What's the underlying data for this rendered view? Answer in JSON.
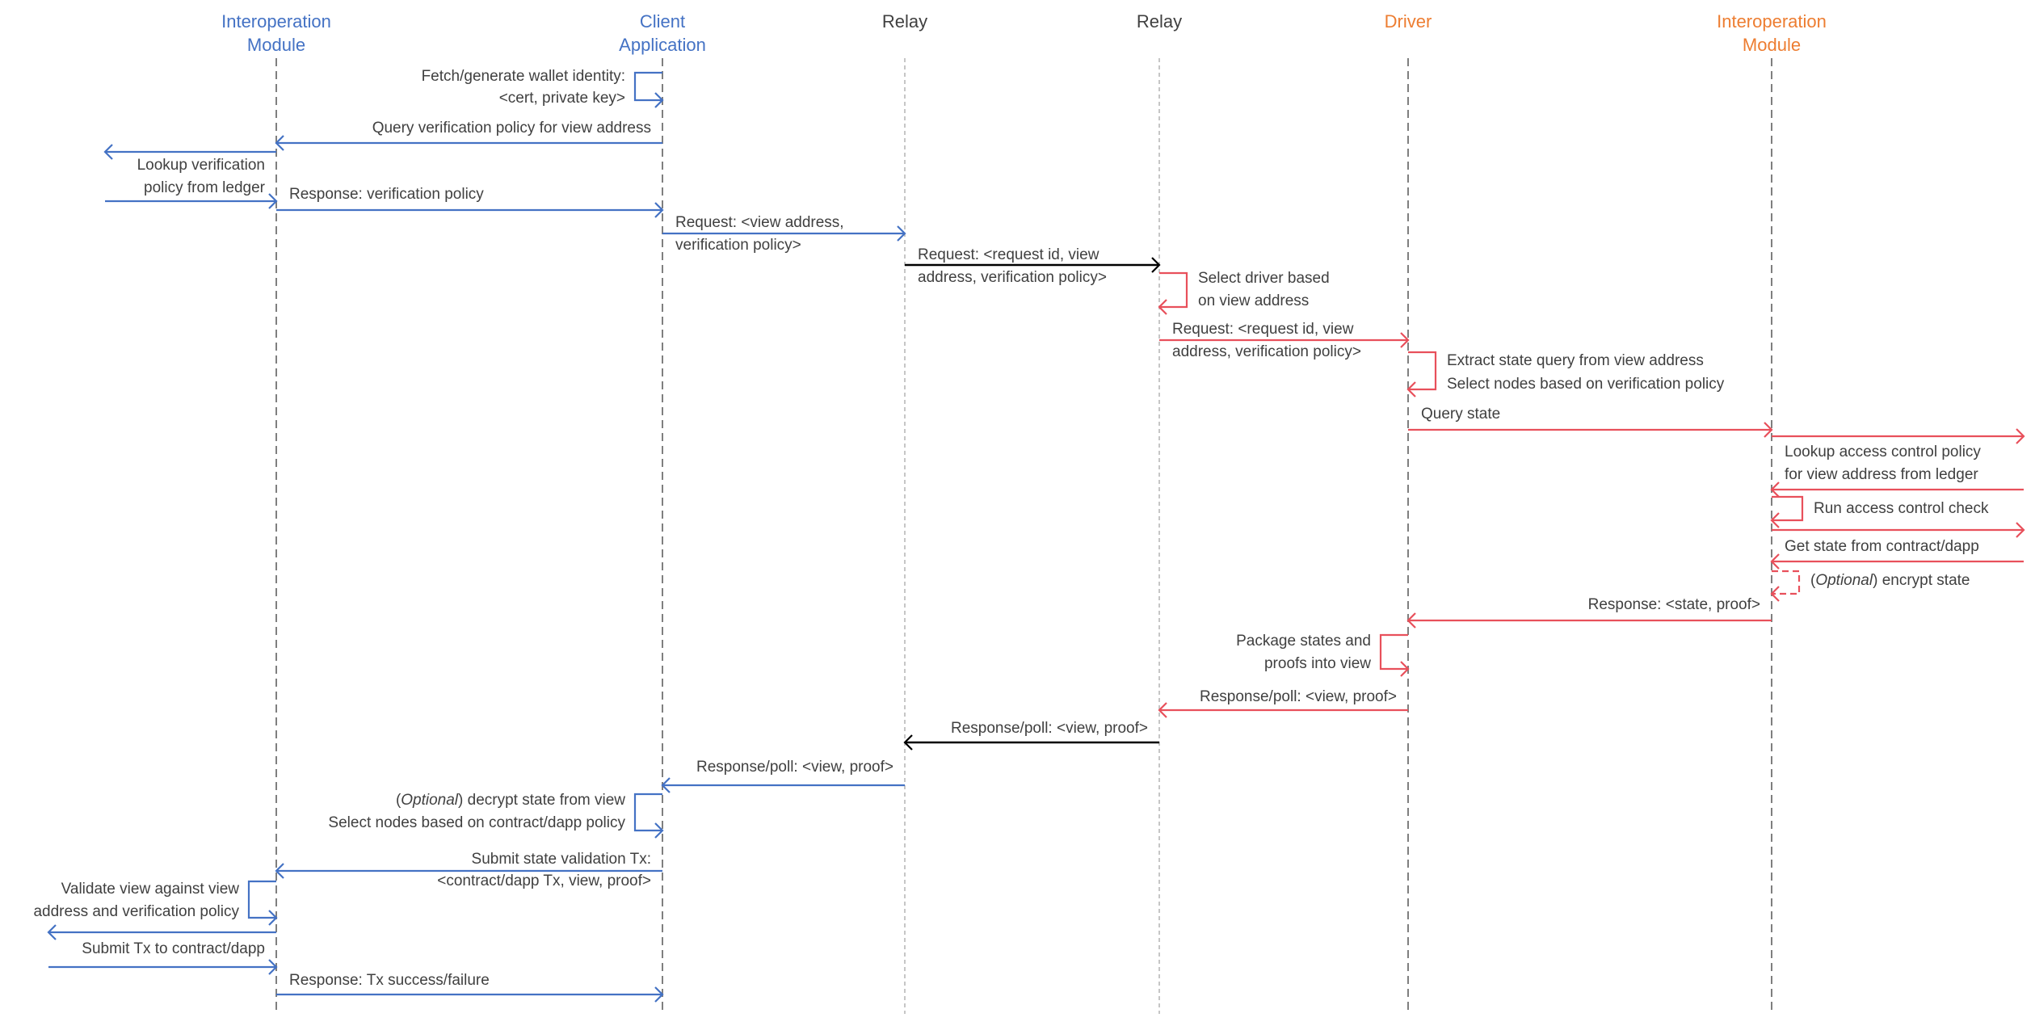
{
  "colors": {
    "blue": "#4472C4",
    "red": "#E8505B",
    "orange": "#ED7D31",
    "black": "#000000",
    "text": "#404040",
    "lifeline": "#808080"
  },
  "participants": [
    {
      "id": "im-left",
      "label": [
        "Interoperation",
        "Module"
      ],
      "color": "blue"
    },
    {
      "id": "client",
      "label": [
        "Client",
        "Application"
      ],
      "color": "blue"
    },
    {
      "id": "relay-1",
      "label": [
        "Relay"
      ],
      "color": "text"
    },
    {
      "id": "relay-2",
      "label": [
        "Relay"
      ],
      "color": "text"
    },
    {
      "id": "driver",
      "label": [
        "Driver"
      ],
      "color": "orange"
    },
    {
      "id": "im-right",
      "label": [
        "Interoperation",
        "Module"
      ],
      "color": "orange"
    }
  ],
  "messages": [
    {
      "type": "self",
      "at": 1,
      "side": "left",
      "color": "blue",
      "text": [
        "Fetch/generate wallet identity:",
        "<cert, private key>"
      ]
    },
    {
      "type": "arrow",
      "from": 1,
      "to": 0,
      "color": "blue",
      "text": [
        "Query verification policy for view address"
      ]
    },
    {
      "type": "external-out",
      "at": 0,
      "side": "left",
      "color": "blue",
      "text": []
    },
    {
      "type": "note",
      "at": 0,
      "side": "left",
      "text": [
        "Lookup verification",
        "policy from ledger"
      ]
    },
    {
      "type": "external-in",
      "at": 0,
      "side": "left",
      "color": "blue",
      "text": []
    },
    {
      "type": "arrow",
      "from": 0,
      "to": 1,
      "color": "blue",
      "text": [
        "Response: verification policy"
      ]
    },
    {
      "type": "arrow",
      "from": 1,
      "to": 2,
      "color": "blue",
      "text": [
        "Request: <view address,",
        "verification policy>"
      ]
    },
    {
      "type": "arrow",
      "from": 2,
      "to": 3,
      "color": "black",
      "text": [
        "Request: <request id, view",
        "address, verification policy>"
      ]
    },
    {
      "type": "self",
      "at": 3,
      "side": "right",
      "color": "red",
      "text": [
        "Select driver based",
        "on view address"
      ]
    },
    {
      "type": "arrow",
      "from": 3,
      "to": 4,
      "color": "red",
      "text": [
        "Request: <request id, view",
        "address, verification policy>"
      ]
    },
    {
      "type": "self",
      "at": 4,
      "side": "right",
      "color": "red",
      "text": [
        "Extract state query from view address",
        "Select nodes based on verification policy"
      ]
    },
    {
      "type": "arrow",
      "from": 4,
      "to": 5,
      "color": "red",
      "text": [
        "Query state"
      ]
    },
    {
      "type": "external-out",
      "at": 5,
      "side": "right",
      "color": "red",
      "text": []
    },
    {
      "type": "note",
      "at": 5,
      "side": "right",
      "text": [
        "Lookup access control policy",
        "for view address from ledger"
      ]
    },
    {
      "type": "external-in",
      "at": 5,
      "side": "right",
      "color": "red",
      "text": []
    },
    {
      "type": "self",
      "at": 5,
      "side": "right",
      "color": "red",
      "text": [
        "Run access control check"
      ]
    },
    {
      "type": "external-out",
      "at": 5,
      "side": "right",
      "color": "red",
      "text": []
    },
    {
      "type": "note",
      "at": 5,
      "side": "right",
      "text": [
        "Get state from contract/dapp"
      ]
    },
    {
      "type": "external-in",
      "at": 5,
      "side": "right",
      "color": "red",
      "text": []
    },
    {
      "type": "self",
      "at": 5,
      "side": "right",
      "color": "red",
      "dashed": true,
      "text": [
        "(",
        "Optional",
        ") encrypt state"
      ]
    },
    {
      "type": "arrow",
      "from": 5,
      "to": 4,
      "color": "red",
      "text": [
        "Response: <state, proof>"
      ]
    },
    {
      "type": "self",
      "at": 4,
      "side": "left",
      "color": "red",
      "text": [
        "Package states and",
        "proofs into view"
      ]
    },
    {
      "type": "arrow",
      "from": 4,
      "to": 3,
      "color": "red",
      "text": [
        "Response/poll: <view, proof>"
      ]
    },
    {
      "type": "arrow",
      "from": 3,
      "to": 2,
      "color": "black",
      "text": [
        "Response/poll: <view, proof>"
      ]
    },
    {
      "type": "arrow",
      "from": 2,
      "to": 1,
      "color": "blue",
      "text": [
        "Response/poll: <view, proof>"
      ]
    },
    {
      "type": "self",
      "at": 1,
      "side": "left",
      "color": "blue",
      "text": [
        "(",
        "Optional",
        ") decrypt state from view",
        "Select nodes based on contract/dapp policy"
      ]
    },
    {
      "type": "arrow",
      "from": 1,
      "to": 0,
      "color": "blue",
      "text": [
        "Submit state validation Tx:",
        "<contract/dapp Tx, view, proof>"
      ]
    },
    {
      "type": "self",
      "at": 0,
      "side": "left",
      "color": "blue",
      "text": [
        "Validate view against view",
        "address and verification policy"
      ]
    },
    {
      "type": "external-out",
      "at": 0,
      "side": "left",
      "color": "blue",
      "text": []
    },
    {
      "type": "note",
      "at": 0,
      "side": "left",
      "text": [
        "Submit Tx to contract/dapp"
      ]
    },
    {
      "type": "external-in",
      "at": 0,
      "side": "left",
      "color": "blue",
      "text": []
    },
    {
      "type": "arrow",
      "from": 0,
      "to": 1,
      "color": "blue",
      "text": [
        "Response: Tx success/failure"
      ]
    }
  ]
}
